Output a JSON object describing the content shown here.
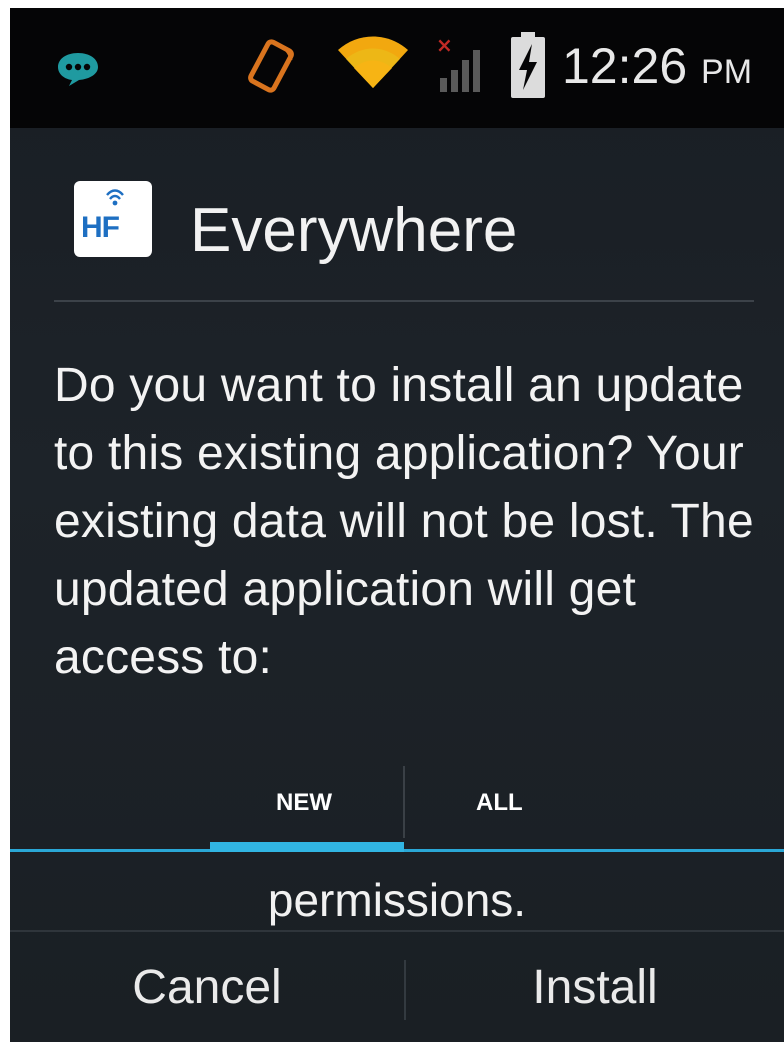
{
  "status_bar": {
    "time": "12:26",
    "ampm": "PM",
    "icons": [
      "chat-notification-icon",
      "screen-rotation-icon",
      "wifi-icon",
      "signal-no-service-icon",
      "battery-charging-icon"
    ]
  },
  "dialog": {
    "app_icon_text": "HF",
    "app_name": "Everywhere",
    "message": "Do you want to install an update to this existing application? Your existing data will not be lost. The updated application will get access to:",
    "tabs": [
      {
        "label": "NEW",
        "selected": true
      },
      {
        "label": "ALL",
        "selected": false
      }
    ],
    "permissions_text": "permissions.",
    "buttons": {
      "cancel": "Cancel",
      "install": "Install"
    }
  },
  "colors": {
    "accent": "#31b5e3",
    "background": "#1d2329",
    "status_bar": "#050506"
  }
}
